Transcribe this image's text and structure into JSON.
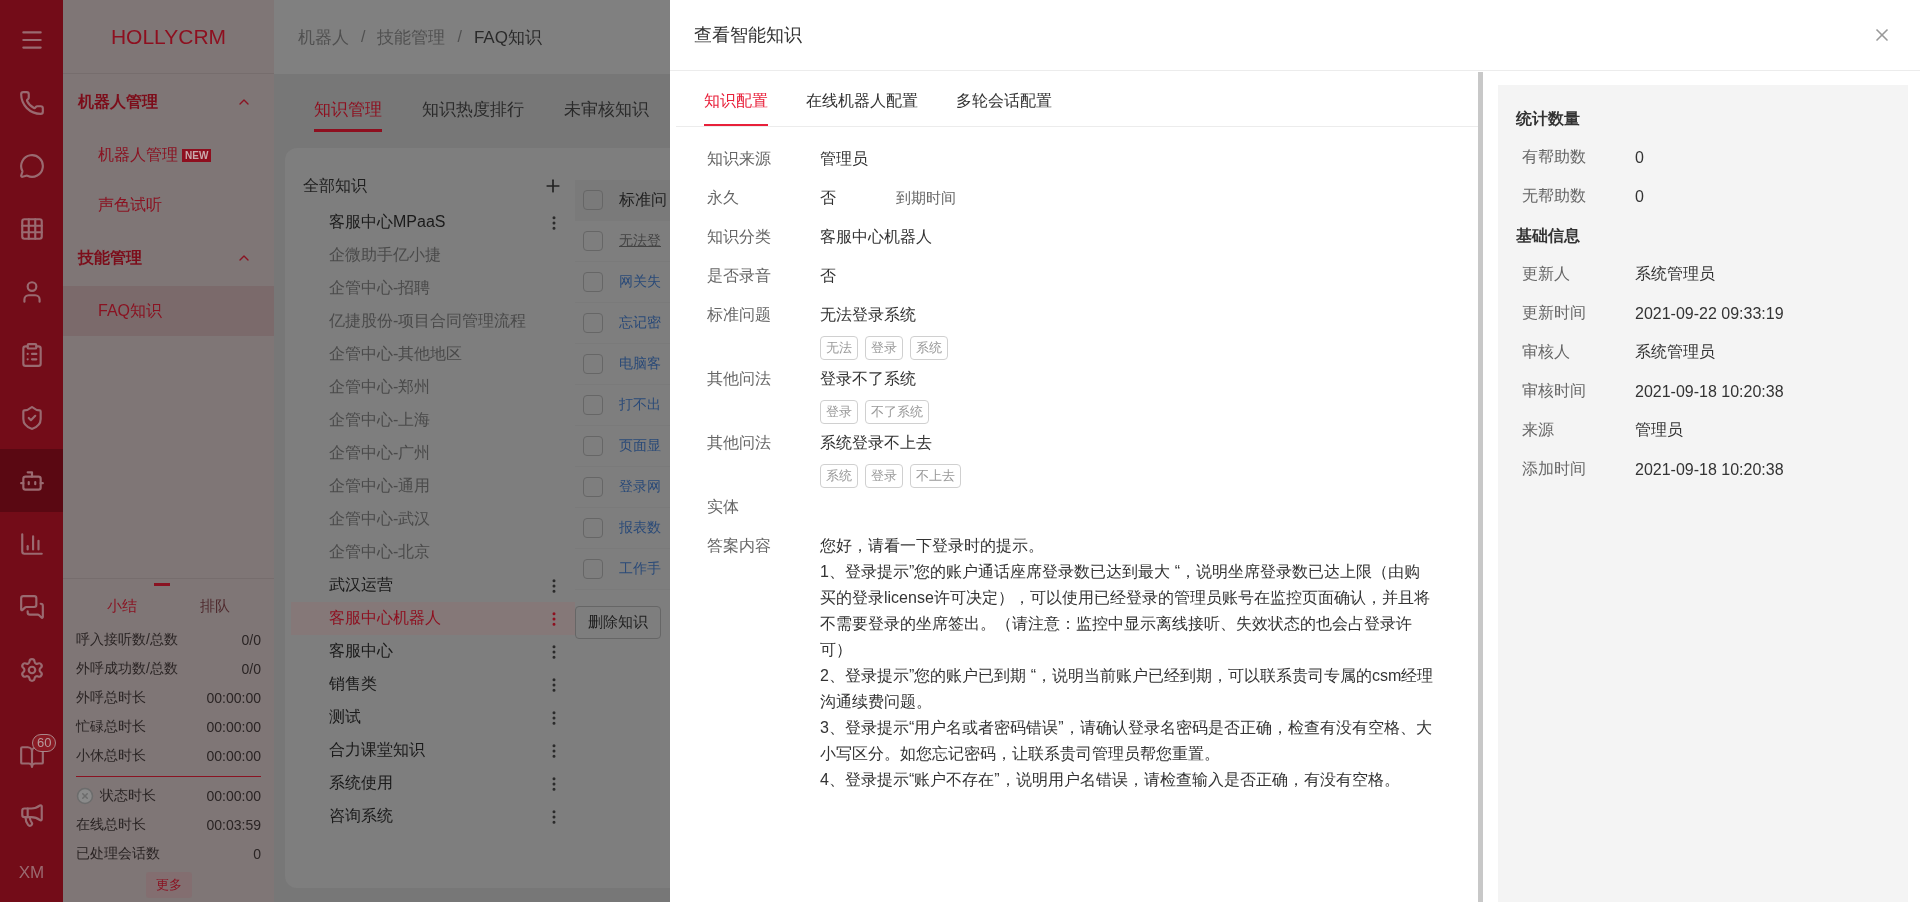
{
  "rail": {
    "items": [
      {
        "selected": false
      },
      {
        "selected": false
      },
      {
        "selected": false
      },
      {
        "selected": false
      },
      {
        "selected": false
      },
      {
        "selected": false
      },
      {
        "selected": false
      },
      {
        "selected": true
      },
      {
        "selected": false
      },
      {
        "selected": false
      },
      {
        "selected": false
      }
    ],
    "bottom": [
      {
        "badge": "60",
        "selected": false
      },
      {
        "selected": false
      }
    ],
    "user": "XM"
  },
  "nav": {
    "logo": "HOLLYCRM",
    "groups": [
      {
        "title": "机器人管理",
        "expanded": true,
        "items": [
          {
            "label": "机器人管理",
            "badge": "NEW",
            "selected": false
          },
          {
            "label": "声色试听",
            "selected": false
          }
        ]
      },
      {
        "title": "技能管理",
        "expanded": true,
        "items": [
          {
            "label": "FAQ知识",
            "selected": true
          }
        ]
      }
    ]
  },
  "stats": {
    "tabs": [
      {
        "label": "小结",
        "selected": true
      },
      {
        "label": "排队",
        "selected": false
      }
    ],
    "rows": [
      {
        "label": "呼入接听数/总数",
        "value": "0/0"
      },
      {
        "label": "外呼成功数/总数",
        "value": "0/0"
      },
      {
        "label": "外呼总时长",
        "value": "00:00:00"
      },
      {
        "label": "忙碌总时长",
        "value": "00:00:00"
      },
      {
        "label": "小休总时长",
        "value": "00:00:00"
      }
    ],
    "status_rows": [
      {
        "kind": "status",
        "label": "状态时长",
        "value": "00:00:00"
      },
      {
        "kind": "plain",
        "label": "在线总时长",
        "value": "00:03:59"
      },
      {
        "kind": "plain",
        "label": "已处理会话数",
        "value": "0"
      }
    ],
    "more": "更多"
  },
  "breadcrumb": {
    "separator": "/",
    "items": [
      "机器人",
      "技能管理",
      "FAQ知识"
    ]
  },
  "main_tabs": [
    {
      "label": "知识管理",
      "selected": true
    },
    {
      "label": "知识热度排行",
      "selected": false
    },
    {
      "label": "未审核知识",
      "selected": false
    }
  ],
  "tree": {
    "title": "全部知识",
    "items": [
      {
        "label": "客服中心MPaaS",
        "disabled": false,
        "selected": false
      },
      {
        "label": "企微助手亿小捷",
        "disabled": true,
        "selected": false
      },
      {
        "label": "企管中心-招聘",
        "disabled": true,
        "selected": false
      },
      {
        "label": "亿捷股份-项目合同管理流程",
        "disabled": true,
        "selected": false
      },
      {
        "label": "企管中心-其他地区",
        "disabled": true,
        "selected": false
      },
      {
        "label": "企管中心-郑州",
        "disabled": true,
        "selected": false
      },
      {
        "label": "企管中心-上海",
        "disabled": true,
        "selected": false
      },
      {
        "label": "企管中心-广州",
        "disabled": true,
        "selected": false
      },
      {
        "label": "企管中心-通用",
        "disabled": true,
        "selected": false
      },
      {
        "label": "企管中心-武汉",
        "disabled": true,
        "selected": false
      },
      {
        "label": "企管中心-北京",
        "disabled": true,
        "selected": false
      },
      {
        "label": "武汉运营",
        "disabled": false,
        "selected": false
      },
      {
        "label": "客服中心机器人",
        "disabled": false,
        "selected": true
      },
      {
        "label": "客服中心",
        "disabled": false,
        "selected": false
      },
      {
        "label": "销售类",
        "disabled": false,
        "selected": false
      },
      {
        "label": "测试",
        "disabled": false,
        "selected": false
      },
      {
        "label": "合力课堂知识",
        "disabled": false,
        "selected": false
      },
      {
        "label": "系统使用",
        "disabled": false,
        "selected": false
      },
      {
        "label": "咨询系统",
        "disabled": false,
        "selected": false
      }
    ]
  },
  "table": {
    "column_1": "标准问",
    "header_checked": false,
    "rows": [
      {
        "text": "无法登",
        "visited": true,
        "checked": false
      },
      {
        "text": "网关失",
        "visited": false,
        "checked": false
      },
      {
        "text": "忘记密",
        "visited": false,
        "checked": false
      },
      {
        "text": "电脑客",
        "visited": false,
        "checked": false
      },
      {
        "text": "打不出",
        "visited": false,
        "checked": false
      },
      {
        "text": "页面显",
        "visited": false,
        "checked": false
      },
      {
        "text": "登录网",
        "visited": false,
        "checked": false
      },
      {
        "text": "报表数",
        "visited": false,
        "checked": false
      },
      {
        "text": "工作手",
        "visited": false,
        "checked": false
      }
    ],
    "delete_button": "删除知识"
  },
  "drawer": {
    "title": "查看智能知识",
    "tabs": [
      {
        "label": "知识配置",
        "selected": true
      },
      {
        "label": "在线机器人配置",
        "selected": false
      },
      {
        "label": "多轮会话配置",
        "selected": false
      }
    ],
    "fields": [
      {
        "kind": "text",
        "label": "知识来源",
        "value": "管理员"
      },
      {
        "kind": "text",
        "label": "永久",
        "value": "否",
        "extra": "到期时间"
      },
      {
        "kind": "text",
        "label": "知识分类",
        "value": "客服中心机器人"
      },
      {
        "kind": "text",
        "label": "是否录音",
        "value": "否"
      },
      {
        "kind": "question",
        "label": "标准问题",
        "value": "无法登录系统",
        "tags": [
          "无法",
          "登录",
          "系统"
        ]
      },
      {
        "kind": "question",
        "label": "其他问法",
        "value": "登录不了系统",
        "tags": [
          "登录",
          "不了系统"
        ]
      },
      {
        "kind": "question",
        "label": "其他问法",
        "value": "系统登录不上去",
        "tags": [
          "系统",
          "登录",
          "不上去"
        ]
      },
      {
        "kind": "text",
        "label": "实体"
      },
      {
        "kind": "answer",
        "label": "答案内容",
        "paragraphs": [
          "您好，请看一下登录时的提示。",
          "1、登录提示”您的账户通话座席登录数已达到最大 “，说明坐席登录数已达上限（由购买的登录license许可决定），可以使用已经登录的管理员账号在监控页面确认，并且将不需要登录的坐席签出。（请注意：监控中显示离线接听、失效状态的也会占登录许可）",
          "2、登录提示”您的账户已到期 “，说明当前账户已经到期，可以联系贵司专属的csm经理沟通续费问题。",
          "3、登录提示“用户名或者密码错误”，请确认登录名密码是否正确，检查有没有空格、大小写区分。如您忘记密码，让联系贵司管理员帮您重置。",
          "4、登录提示“账户不存在”，说明用户名错误，请检查输入是否正确，有没有空格。"
        ]
      }
    ],
    "side": {
      "sections": [
        {
          "title": "统计数量",
          "rows": [
            {
              "label": "有帮助数",
              "value": "0"
            },
            {
              "label": "无帮助数",
              "value": "0"
            }
          ]
        },
        {
          "title": "基础信息",
          "rows": [
            {
              "label": "更新人",
              "value": "系统管理员"
            },
            {
              "label": "更新时间",
              "value": "2021-09-22 09:33:19"
            },
            {
              "label": "审核人",
              "value": "系统管理员"
            },
            {
              "label": "审核时间",
              "value": "2021-09-18 10:20:38"
            },
            {
              "label": "来源",
              "value": "管理员"
            },
            {
              "label": "添加时间",
              "value": "2021-09-18 10:20:38"
            }
          ]
        }
      ]
    }
  }
}
